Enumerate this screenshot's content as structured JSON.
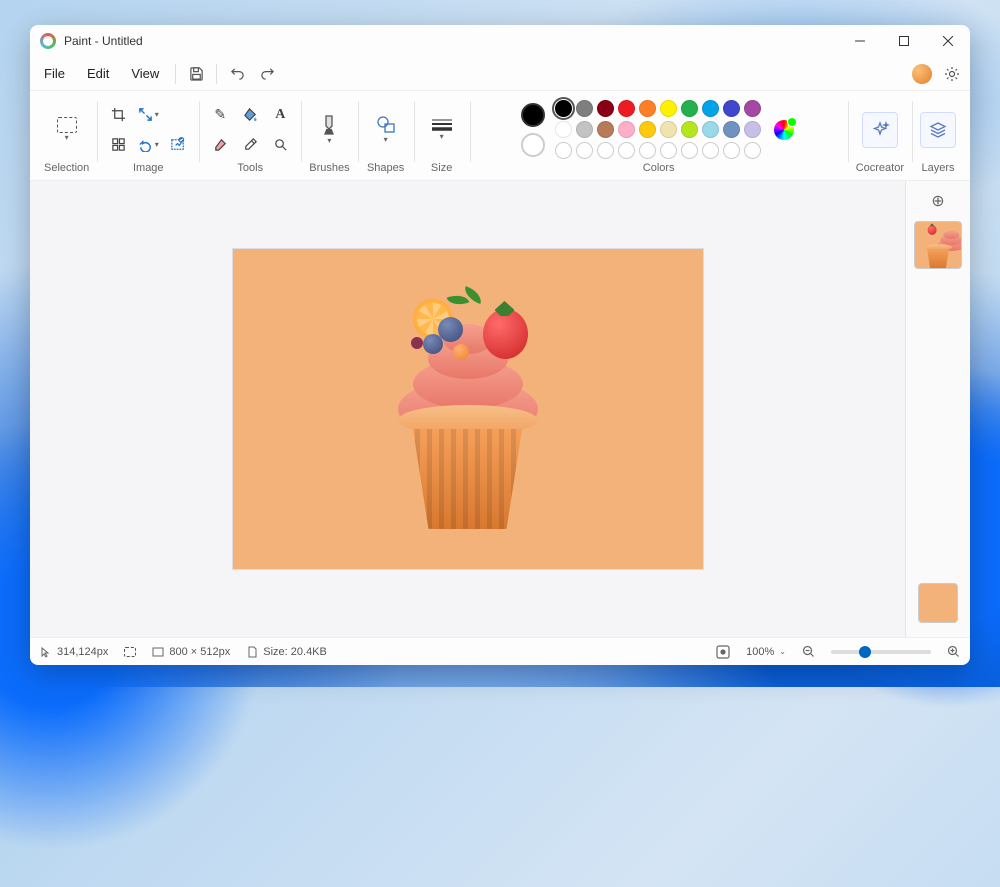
{
  "title": "Paint - Untitled",
  "menu": {
    "file": "File",
    "edit": "Edit",
    "view": "View"
  },
  "ribbon": {
    "selection": "Selection",
    "image": "Image",
    "tools": "Tools",
    "brushes": "Brushes",
    "shapes": "Shapes",
    "size": "Size",
    "colors": "Colors",
    "cocreator": "Cocreator",
    "layers": "Layers"
  },
  "palette": {
    "row1": [
      "#000000",
      "#7f7f7f",
      "#880015",
      "#ed1c24",
      "#ff7f27",
      "#fff200",
      "#22b14c",
      "#00a2e8",
      "#3f48cc",
      "#a349a4"
    ],
    "row2": [
      "#ffffff",
      "#c3c3c3",
      "#b97a57",
      "#ffaec9",
      "#ffc90e",
      "#efe4b0",
      "#b5e61d",
      "#99d9ea",
      "#7092be",
      "#c8bfe7"
    ],
    "selected": "#000000",
    "secondary": "#ffffff"
  },
  "status": {
    "cursor": "314,124px",
    "dims": "800  ×  512px",
    "filesize": "Size: 20.4KB",
    "zoom": "100%"
  },
  "canvas": {
    "bg": "#f3b27a",
    "subject": "cupcake with fruit"
  }
}
